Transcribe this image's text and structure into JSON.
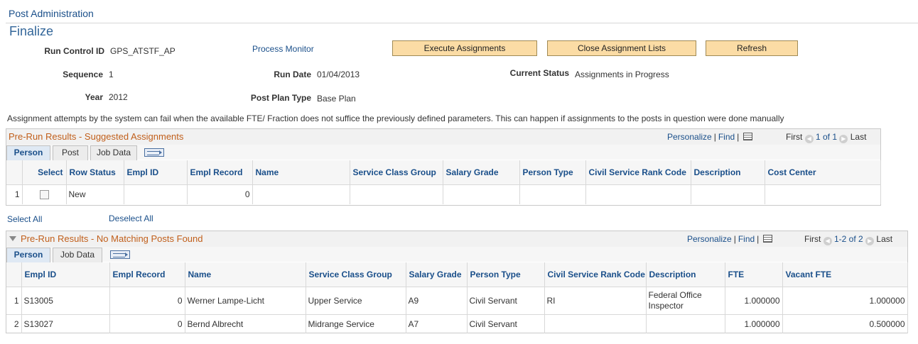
{
  "breadcrumb": "Post Administration",
  "page_title": "Finalize",
  "fields": {
    "run_control_id": {
      "label": "Run Control ID",
      "value": "GPS_ATSTF_AP"
    },
    "sequence": {
      "label": "Sequence",
      "value": "1"
    },
    "year": {
      "label": "Year",
      "value": "2012"
    },
    "run_date": {
      "label": "Run Date",
      "value": "01/04/2013"
    },
    "post_plan_type": {
      "label": "Post Plan Type",
      "value": "Base Plan"
    },
    "current_status": {
      "label": "Current Status",
      "value": "Assignments in Progress"
    }
  },
  "process_monitor_link": "Process Monitor",
  "buttons": {
    "execute": "Execute Assignments",
    "close_lists": "Close Assignment Lists",
    "refresh": "Refresh"
  },
  "notice": "Assignment attempts by the system can fail when the available FTE/ Fraction does not suffice the previously defined parameters. This can happen if assignments to the posts in question were done manually",
  "grid1": {
    "title": "Pre-Run Results - Suggested Assignments",
    "personalize": "Personalize",
    "sep": "|",
    "find": "Find",
    "first": "First",
    "range": "1 of 1",
    "last": "Last",
    "tabs": [
      "Person",
      "Post",
      "Job Data"
    ],
    "columns": [
      "Select",
      "Row Status",
      "Empl ID",
      "Empl Record",
      "Name",
      "Service Class Group",
      "Salary Grade",
      "Person Type",
      "Civil Service Rank Code",
      "Description",
      "Cost Center"
    ],
    "rows": [
      {
        "num": "1",
        "row_status": "New",
        "empl_id": "",
        "empl_record": "0",
        "name": "",
        "service_class_group": "",
        "salary_grade": "",
        "person_type": "",
        "rank_code": "",
        "description": "",
        "cost_center": ""
      }
    ]
  },
  "select_all": "Select All",
  "deselect_all": "Deselect All",
  "grid2": {
    "title": "Pre-Run Results - No Matching Posts Found",
    "personalize": "Personalize",
    "sep": "|",
    "find": "Find",
    "first": "First",
    "range": "1-2 of 2",
    "last": "Last",
    "tabs": [
      "Person",
      "Job Data"
    ],
    "columns": [
      "Empl ID",
      "Empl Record",
      "Name",
      "Service Class Group",
      "Salary Grade",
      "Person Type",
      "Civil Service Rank Code",
      "Description",
      "FTE",
      "Vacant FTE"
    ],
    "rows": [
      {
        "num": "1",
        "empl_id": "S13005",
        "empl_record": "0",
        "name": "Werner Lampe-Licht",
        "service_class_group": "Upper Service",
        "salary_grade": "A9",
        "person_type": "Civil Servant",
        "rank_code": "RI",
        "description": "Federal Office Inspector",
        "fte": "1.000000",
        "vacant_fte": "1.000000"
      },
      {
        "num": "2",
        "empl_id": "S13027",
        "empl_record": "0",
        "name": "Bernd Albrecht",
        "service_class_group": "Midrange Service",
        "salary_grade": "A7",
        "person_type": "Civil Servant",
        "rank_code": "",
        "description": "",
        "fte": "1.000000",
        "vacant_fte": "0.500000"
      }
    ]
  }
}
